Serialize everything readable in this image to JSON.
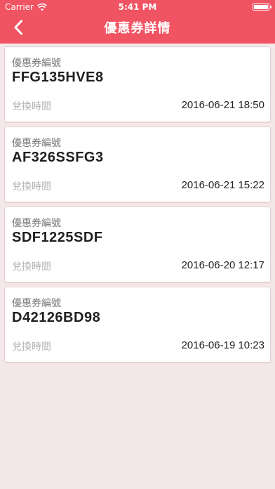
{
  "status_bar": {
    "carrier": "Carrier",
    "time": "5:41 PM",
    "icons": [
      "wifi-icon",
      "battery-icon"
    ]
  },
  "nav": {
    "title": "優惠券詳情",
    "back_icon": "chevron-left-icon"
  },
  "colors": {
    "header": "#f05362",
    "background": "#f5e8ea",
    "card": "#ffffff",
    "label": "#777777",
    "muted_label": "#b3b3b3"
  },
  "coupons": [
    {
      "code_label": "優惠券編號",
      "code": "FFG135HVE8",
      "redeem_label": "兌換時間",
      "redeem_time": "2016-06-21 18:50"
    },
    {
      "code_label": "優惠券編號",
      "code": "AF326SSFG3",
      "redeem_label": "兌換時間",
      "redeem_time": "2016-06-21 15:22"
    },
    {
      "code_label": "優惠券編號",
      "code": "SDF1225SDF",
      "redeem_label": "兌換時間",
      "redeem_time": "2016-06-20 12:17"
    },
    {
      "code_label": "優惠券編號",
      "code": "D42126BD98",
      "redeem_label": "兌換時間",
      "redeem_time": "2016-06-19 10:23"
    }
  ]
}
